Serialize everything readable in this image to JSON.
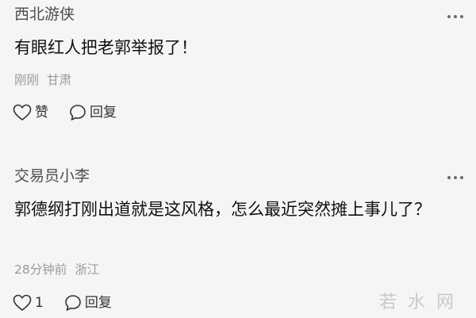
{
  "comments": [
    {
      "username": "西北游侠",
      "text": "有眼红人把老郭举报了！",
      "time": "刚刚",
      "location": "甘肃",
      "like_label": "赞",
      "reply_label": "回复"
    },
    {
      "username": "交易员小李",
      "text": "郭德纲打刚出道就是这风格，怎么最近突然摊上事儿了？",
      "time": "28分钟前",
      "location": "浙江",
      "like_label": "1",
      "reply_label": "回复"
    }
  ],
  "watermark": "若水网",
  "icons": {
    "more": "more-dots-icon",
    "like": "heart-icon",
    "reply": "speech-bubble-icon"
  }
}
